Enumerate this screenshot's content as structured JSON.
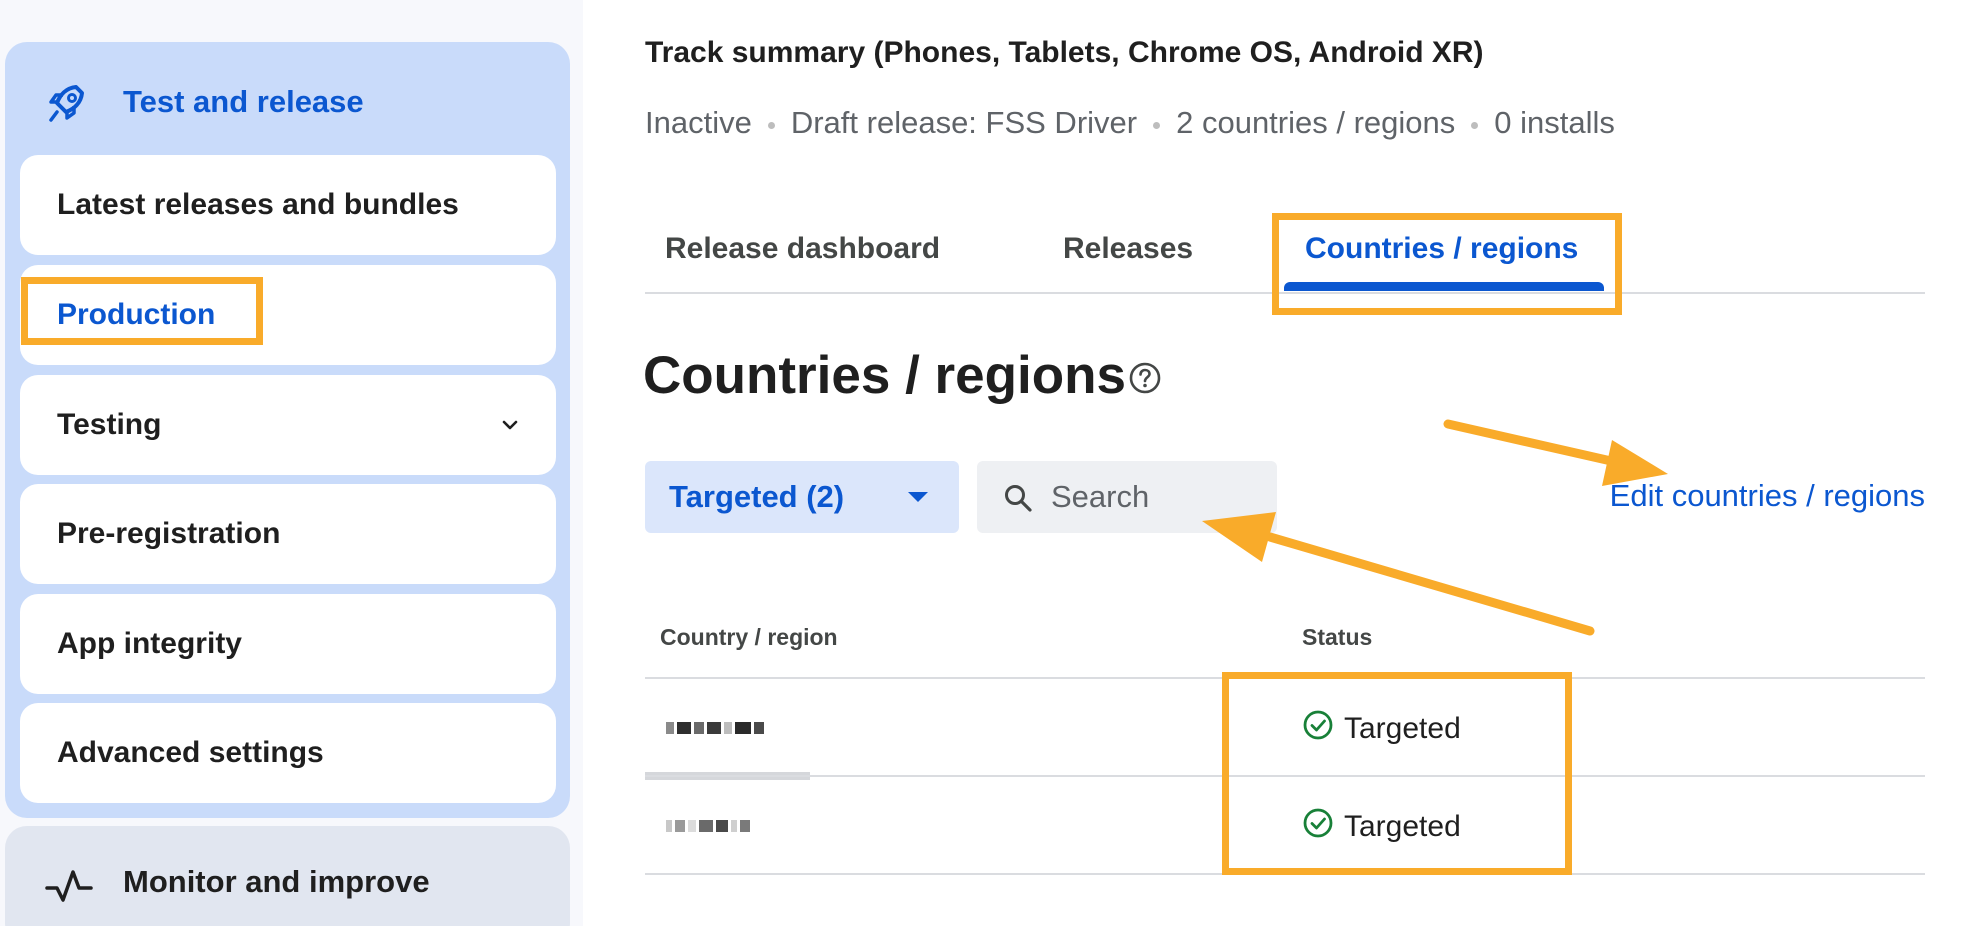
{
  "sidebar": {
    "section_title": "Test and release",
    "items": [
      {
        "label": "Latest releases and bundles"
      },
      {
        "label": "Production"
      },
      {
        "label": "Testing"
      },
      {
        "label": "Pre-registration"
      },
      {
        "label": "App integrity"
      },
      {
        "label": "Advanced settings"
      }
    ],
    "next_section_title": "Monitor and improve"
  },
  "header": {
    "title": "Track summary (Phones, Tablets, Chrome OS, Android XR)",
    "meta": [
      "Inactive",
      "Draft release: FSS Driver",
      "2 countries / regions",
      "0 installs"
    ]
  },
  "tabs": [
    {
      "label": "Release dashboard"
    },
    {
      "label": "Releases"
    },
    {
      "label": "Countries / regions",
      "active": true
    }
  ],
  "page": {
    "heading": "Countries / regions",
    "filter_label": "Targeted (2)",
    "search_placeholder": "Search",
    "edit_link": "Edit countries / regions"
  },
  "table": {
    "columns": [
      "Country / region",
      "Status"
    ],
    "rows": [
      {
        "status": "Targeted"
      },
      {
        "status": "Targeted"
      }
    ]
  },
  "colors": {
    "accent": "#0b57d0",
    "highlight": "#f9ab2a",
    "success": "#188038"
  }
}
